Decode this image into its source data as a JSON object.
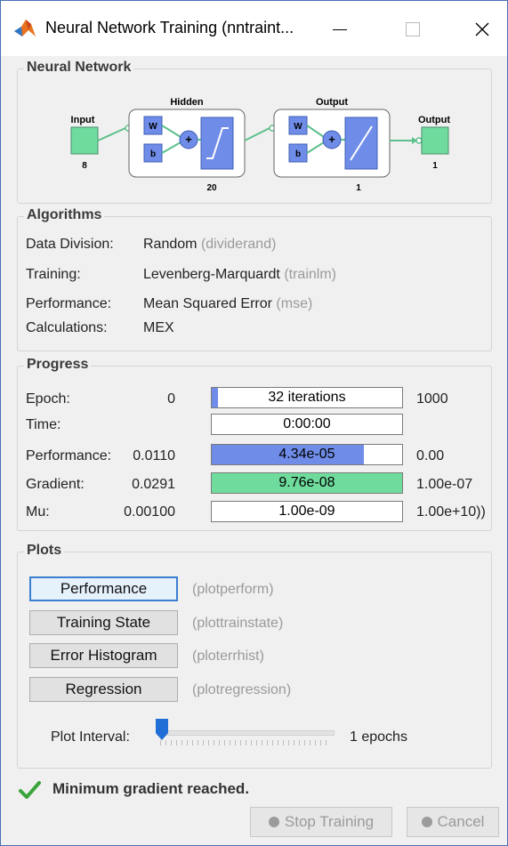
{
  "window": {
    "title": "Neural Network Training (nntraint..."
  },
  "network": {
    "panel_title": "Neural Network",
    "input_label": "Input",
    "input_size": "8",
    "hidden_label": "Hidden",
    "hidden_size": "20",
    "output_layer_label": "Output",
    "output_layer_size": "1",
    "output_label": "Output",
    "output_size": "1",
    "w": "W",
    "b": "b",
    "plus": "+"
  },
  "algorithms": {
    "panel_title": "Algorithms",
    "rows": [
      {
        "label": "Data Division:",
        "value": "Random",
        "fn": "(dividerand)"
      },
      {
        "label": "Training:",
        "value": "Levenberg-Marquardt",
        "fn": "(trainlm)"
      },
      {
        "label": "Performance:",
        "value": "Mean Squared Error",
        "fn": "(mse)"
      },
      {
        "label": "Calculations:",
        "value": "MEX",
        "fn": ""
      }
    ]
  },
  "progress": {
    "panel_title": "Progress",
    "rows": [
      {
        "label": "Epoch:",
        "start": "0",
        "bar_text": "32 iterations",
        "end": "1000",
        "fill_fraction": 0.032,
        "fill_color": "#6f8ce8"
      },
      {
        "label": "Time:",
        "start": "",
        "bar_text": "0:00:00",
        "end": "",
        "fill_fraction": 0,
        "fill_color": "#6f8ce8"
      },
      {
        "label": "Performance:",
        "start": "0.0110",
        "bar_text": "4.34e-05",
        "end": "0.00",
        "fill_fraction": 0.8,
        "fill_color": "#6f8ce8"
      },
      {
        "label": "Gradient:",
        "start": "0.0291",
        "bar_text": "9.76e-08",
        "end": "1.00e-07",
        "fill_fraction": 1.0,
        "fill_color": "#6fdc9e"
      },
      {
        "label": "Mu:",
        "start": "0.00100",
        "bar_text": "1.00e-09",
        "end": "1.00e+10))",
        "fill_fraction": 0,
        "fill_color": "#6f8ce8"
      }
    ]
  },
  "plots": {
    "panel_title": "Plots",
    "buttons": [
      {
        "label": "Performance",
        "fn": "(plotperform)"
      },
      {
        "label": "Training State",
        "fn": "(plottrainstate)"
      },
      {
        "label": "Error Histogram",
        "fn": "(ploterrhist)"
      },
      {
        "label": "Regression",
        "fn": "(plotregression)"
      }
    ],
    "interval_label": "Plot Interval:",
    "interval_value": "1 epochs",
    "slider_position": 0
  },
  "status": {
    "message": "Minimum gradient reached."
  },
  "footer": {
    "stop_label": "Stop Training",
    "cancel_label": "Cancel"
  },
  "colors": {
    "layer_box": "#6f8ce8",
    "input_box": "#6fdc9e",
    "connector": "#5cc08c"
  }
}
